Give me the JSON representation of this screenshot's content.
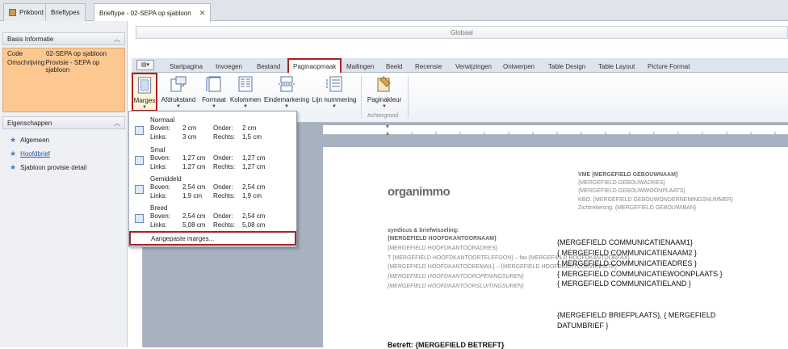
{
  "doc_tabs": [
    {
      "label": "Prikbord",
      "icon": "pin-board-icon"
    },
    {
      "label": "Brieftypes",
      "icon": ""
    },
    {
      "label": "Brieftype - 02-SEPA op sjabloon",
      "icon": "",
      "active": true
    }
  ],
  "left": {
    "basis_header": "Basis Informatie",
    "basis": [
      {
        "key": "Code",
        "value": "02-SEPA op sjabloon"
      },
      {
        "key": "Omschrijving",
        "value": "Provisie - SEPA op sjabloon"
      }
    ],
    "eigenschappen_header": "Eigenschappen",
    "eigenschappen": [
      {
        "label": "Algemeen"
      },
      {
        "label": "Hoofdbrief",
        "link": true
      },
      {
        "label": "Sjabloon provisie detail"
      }
    ]
  },
  "global_label": "Globaal",
  "ribbon_tabs": [
    "Startpagina",
    "Invoegen",
    "Bestand",
    "Paginaopmaak",
    "Mailingen",
    "Beeld",
    "Recensie",
    "Verwijzingen",
    "Ontwerpen",
    "Table Design",
    "Table Layout",
    "Picture Format"
  ],
  "ribbon": {
    "marges": "Marges",
    "afdrukstand": "Afdrukstand",
    "formaat": "Formaat",
    "kolommen": "Kolommen",
    "eindemarkering": "Eindemarkering",
    "lijn_nummering": "Lijn nummering",
    "paginakleur": "Paginakleur",
    "achtergrond": "Achtergrond"
  },
  "margins_menu": {
    "items": [
      {
        "name": "Normaal",
        "boven_label": "Boven:",
        "boven": "2 cm",
        "onder_label": "Onder:",
        "onder": "2 cm",
        "links_label": "Links:",
        "links": "3 cm",
        "rechts_label": "Rechts:",
        "rechts": "1,5 cm"
      },
      {
        "name": "Smal",
        "boven_label": "Boven:",
        "boven": "1,27 cm",
        "onder_label": "Onder:",
        "onder": "1,27 cm",
        "links_label": "Links:",
        "links": "1,27 cm",
        "rechts_label": "Rechts:",
        "rechts": "1,27 cm"
      },
      {
        "name": "Gemiddeld",
        "boven_label": "Boven:",
        "boven": "2,54 cm",
        "onder_label": "Onder:",
        "onder": "2,54 cm",
        "links_label": "Links:",
        "links": "1,9 cm",
        "rechts_label": "Rechts:",
        "rechts": "1,9 cm"
      },
      {
        "name": "Breed",
        "boven_label": "Boven:",
        "boven": "2,54 cm",
        "onder_label": "Onder:",
        "onder": "2,54 cm",
        "links_label": "Links:",
        "links": "5,08 cm",
        "rechts_label": "Rechts:",
        "rechts": "5,08 cm"
      }
    ],
    "custom": "Aangepaste marges..."
  },
  "document": {
    "logo": "organimmo",
    "header_right": [
      "VME {MERGEFIELD GEBOUWNAAM}",
      "{MERGEFIELD GEBOUWADRES}",
      "{MERGEFIELD GEBOUWWOONPLAATS}",
      "KBO: {MERGEFIELD GEBOUWONDERNEMINGSNUMMER}",
      "Zichtrekening: {MERGEFIELD GEBOUWIBAN}"
    ],
    "left_lines": [
      "syndicus & briefwisseling:",
      "{MERGEFIELD HOOFDKANTOORNAAM}",
      "{MERGEFIELD HOOFDKANTOORADRES}",
      "T {MERGEFIELD HOOFDKANTOORTELEFOON} – fax {MERGEFIELD HOOFDKANTOORFAX}",
      "{MERGEFIELD HOOFDKANTOOREMAIL} – {MERGEFIELD HOOFDKANTOORWEBSITE}",
      "{MERGEFIELD HOOFDKANTOOROPENINGSUREN}",
      "{MERGEFIELD HOOFDKANTOORSLUITINGSUREN}"
    ],
    "recipient": [
      "{MERGEFIELD COMMUNICATIENAAM1}",
      "{ MERGEFIELD COMMUNICATIENAAM2 }",
      "{ MERGEFIELD COMMUNICATIEADRES }",
      "{ MERGEFIELD COMMUNICATIEWOONPLAATS }",
      "{ MERGEFIELD COMMUNICATIELAND }"
    ],
    "place_date_1": "{MERGEFIELD BRIEFPLAATS}, { MERGEFIELD",
    "place_date_2": "DATUMBRIEF }",
    "betreft": "Betreft: {MERGEFIELD BETREFT}"
  },
  "colors": {
    "highlight": "#fcc88f",
    "accent_border": "#a82323"
  }
}
